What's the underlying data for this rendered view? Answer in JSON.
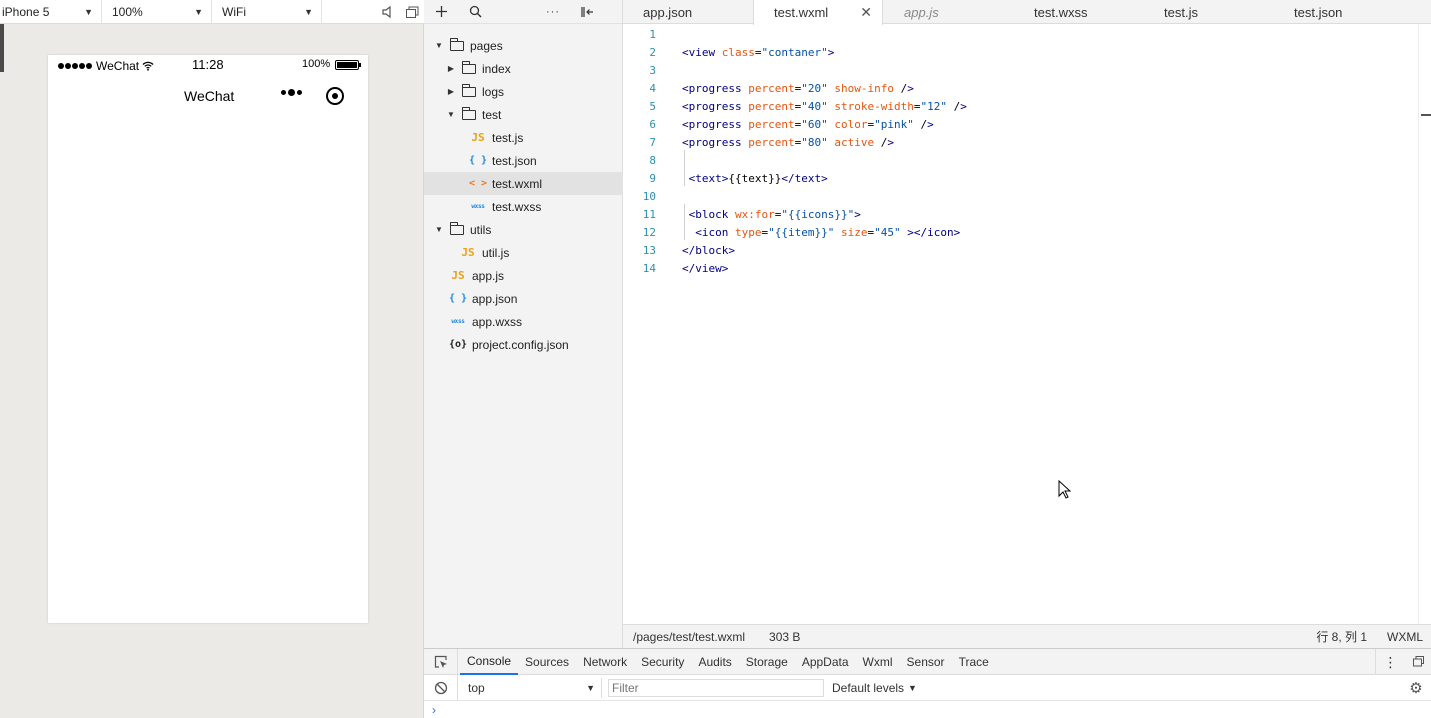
{
  "simulator": {
    "device": "iPhone 5",
    "zoom": "100%",
    "network": "WiFi",
    "status_bar": {
      "carrier": "WeChat",
      "time": "11:28",
      "battery": "100%"
    },
    "nav": {
      "title": "WeChat"
    }
  },
  "explorer": {
    "tree": [
      {
        "label": "pages",
        "type": "folder",
        "expanded": true
      },
      {
        "label": "index",
        "type": "folder",
        "expanded": false
      },
      {
        "label": "logs",
        "type": "folder",
        "expanded": false
      },
      {
        "label": "test",
        "type": "folder",
        "expanded": true
      },
      {
        "label": "test.js",
        "type": "js"
      },
      {
        "label": "test.json",
        "type": "json"
      },
      {
        "label": "test.wxml",
        "type": "wxml",
        "selected": true
      },
      {
        "label": "test.wxss",
        "type": "wxss"
      },
      {
        "label": "utils",
        "type": "folder",
        "expanded": true
      },
      {
        "label": "util.js",
        "type": "js"
      },
      {
        "label": "app.js",
        "type": "js"
      },
      {
        "label": "app.json",
        "type": "json"
      },
      {
        "label": "app.wxss",
        "type": "wxss"
      },
      {
        "label": "project.config.json",
        "type": "project"
      }
    ],
    "icons": {
      "js": "JS",
      "json": "{ }",
      "wxml": "< >",
      "wxss": "wxss",
      "project": "{o}"
    }
  },
  "tabs": [
    {
      "label": "app.json"
    },
    {
      "label": "test.wxml",
      "active": true
    },
    {
      "label": "app.js",
      "preview": true
    },
    {
      "label": "test.wxss"
    },
    {
      "label": "test.js"
    },
    {
      "label": "test.json"
    }
  ],
  "code": {
    "line_numbers": [
      "1",
      "2",
      "3",
      "4",
      "5",
      "6",
      "7",
      "8",
      "9",
      "10",
      "11",
      "12",
      "13",
      "14"
    ],
    "lines": [
      "",
      "<view class=\"contaner\">",
      "",
      "<progress percent=\"20\" show-info />",
      "<progress percent=\"40\" stroke-width=\"12\" />",
      "<progress percent=\"60\" color=\"pink\" />",
      "<progress percent=\"80\" active />",
      "",
      " <text>{{text}}</text>",
      "",
      " <block wx:for=\"{{icons}}\">",
      "  <icon type=\"{{item}}\" size=\"45\" ></icon>",
      "</block>",
      "</view>"
    ]
  },
  "statusbar": {
    "path": "/pages/test/test.wxml",
    "size": "303 B",
    "position": "行 8, 列 1",
    "language": "WXML"
  },
  "devtools": {
    "tabs": [
      "Console",
      "Sources",
      "Network",
      "Security",
      "Audits",
      "Storage",
      "AppData",
      "Wxml",
      "Sensor",
      "Trace"
    ],
    "context": "top",
    "filter_placeholder": "Filter",
    "levels": "Default levels",
    "prompt": "›"
  },
  "colors": {
    "line_number": "#2b91af",
    "tag": "#000080",
    "attribute": "#e6550d",
    "value": "#0451a5",
    "accent": "#1a73e8"
  }
}
